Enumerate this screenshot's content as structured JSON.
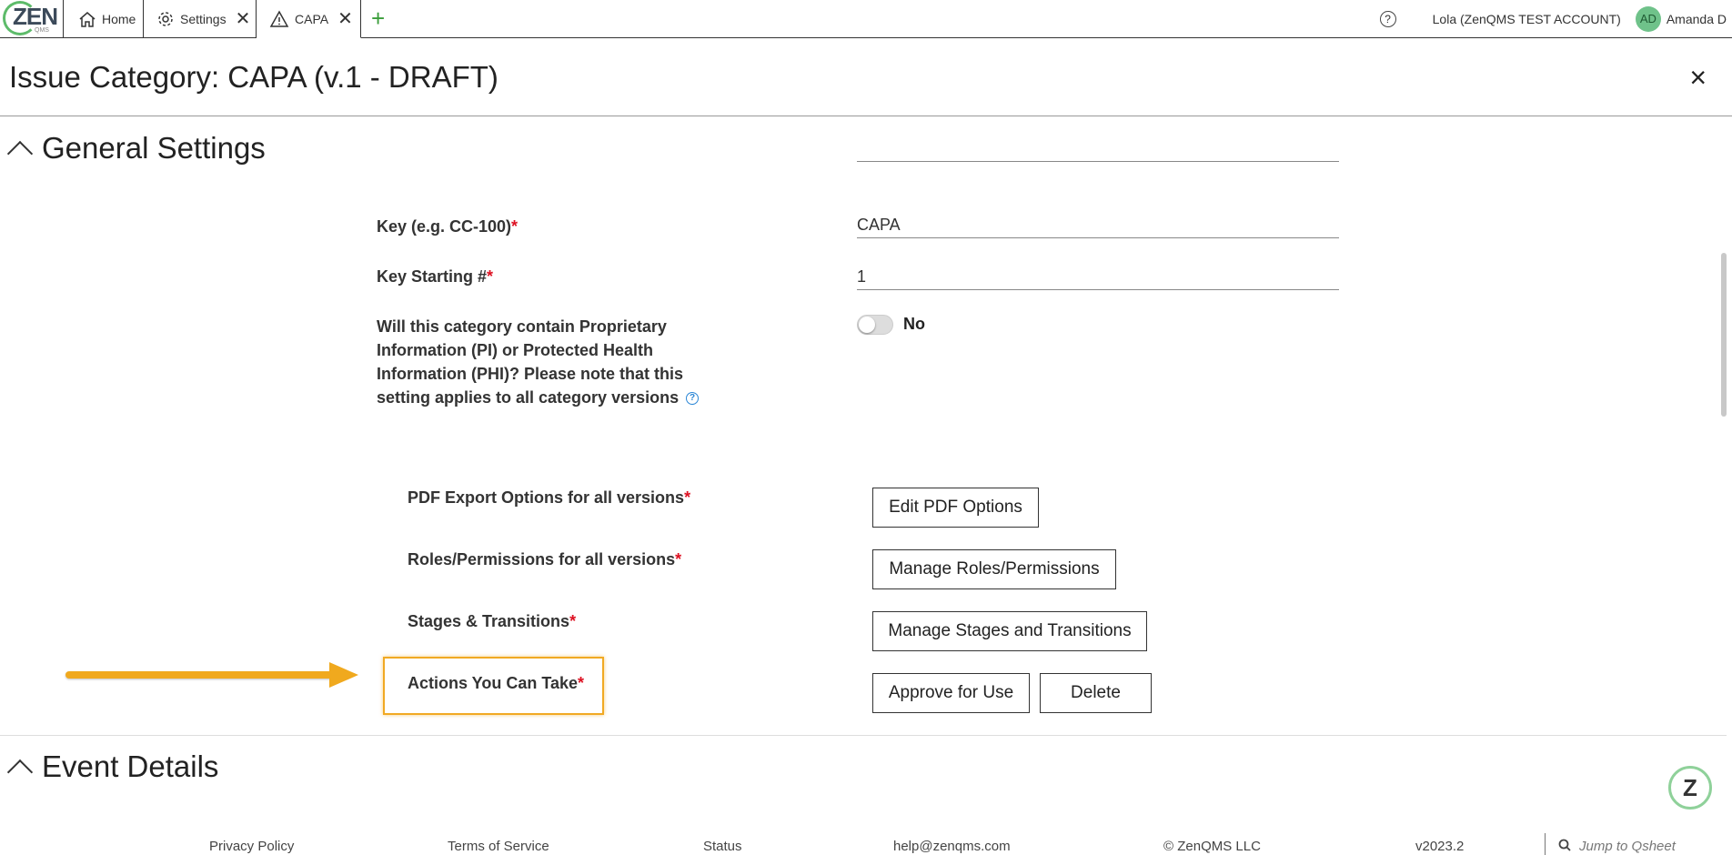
{
  "tabs": {
    "logo_text": "ZEN",
    "logo_sub": "QMS",
    "home_label": "Home",
    "settings_label": "Settings",
    "capa_label": "CAPA",
    "add_label": "+"
  },
  "topright": {
    "help": "?",
    "account": "Lola (ZenQMS TEST ACCOUNT)",
    "avatar_initials": "AD",
    "user_name": "Amanda D"
  },
  "header": {
    "title": "Issue Category: CAPA (v.1 - DRAFT)",
    "close": "×"
  },
  "general_settings": {
    "title": "General Settings",
    "key_label": "Key (e.g. CC-100)",
    "key_value": "CAPA",
    "key_start_label": "Key Starting #",
    "key_start_value": "1",
    "pi_question": "Will this category contain Proprietary Information (PI) or Protected Health Information (PHI)? Please note that this setting applies to all category versions",
    "pi_toggle_label": "No",
    "required_mark": "*",
    "pdf_label": "PDF Export Options for all versions",
    "pdf_button": "Edit PDF Options",
    "roles_label": "Roles/Permissions for all versions",
    "roles_button": "Manage Roles/Permissions",
    "stages_label": "Stages & Transitions",
    "stages_button": "Manage Stages and Transitions",
    "actions_label": "Actions You Can Take",
    "approve_button": "Approve for Use",
    "delete_button": "Delete"
  },
  "event_details": {
    "title": "Event Details"
  },
  "chat_bubble": "Z",
  "footer": {
    "privacy": "Privacy Policy",
    "terms": "Terms of Service",
    "status": "Status",
    "email": "help@zenqms.com",
    "copyright": "© ZenQMS LLC",
    "version": "v2023.2",
    "jump": "Jump to Qsheet"
  },
  "colors": {
    "highlight": "#f1a923",
    "brand_green": "#5dbb6a",
    "required": "#dd1122"
  }
}
